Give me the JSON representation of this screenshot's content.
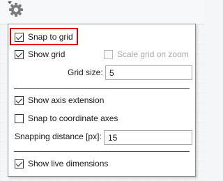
{
  "toolbar": {
    "settings_icon": "gear-icon",
    "dropdown_icon": "caret-down-icon"
  },
  "menu": {
    "snap_to_grid": {
      "label": "Snap to grid",
      "checked": true
    },
    "show_grid": {
      "label": "Show grid",
      "checked": true
    },
    "scale_grid_on_zoom": {
      "label": "Scale grid on zoom",
      "checked": false,
      "disabled": true
    },
    "grid_size": {
      "label": "Grid size:",
      "value": "5"
    },
    "show_axis_extension": {
      "label": "Show axis extension",
      "checked": true
    },
    "snap_to_coordinate_axes": {
      "label": "Snap to coordinate axes",
      "checked": false
    },
    "snapping_distance": {
      "label": "Snapping distance [px]:",
      "value": "15"
    },
    "show_live_dimensions": {
      "label": "Show live dimensions",
      "checked": true
    }
  },
  "colors": {
    "highlight": "#e00000",
    "menu_border": "#8f8f8f"
  }
}
